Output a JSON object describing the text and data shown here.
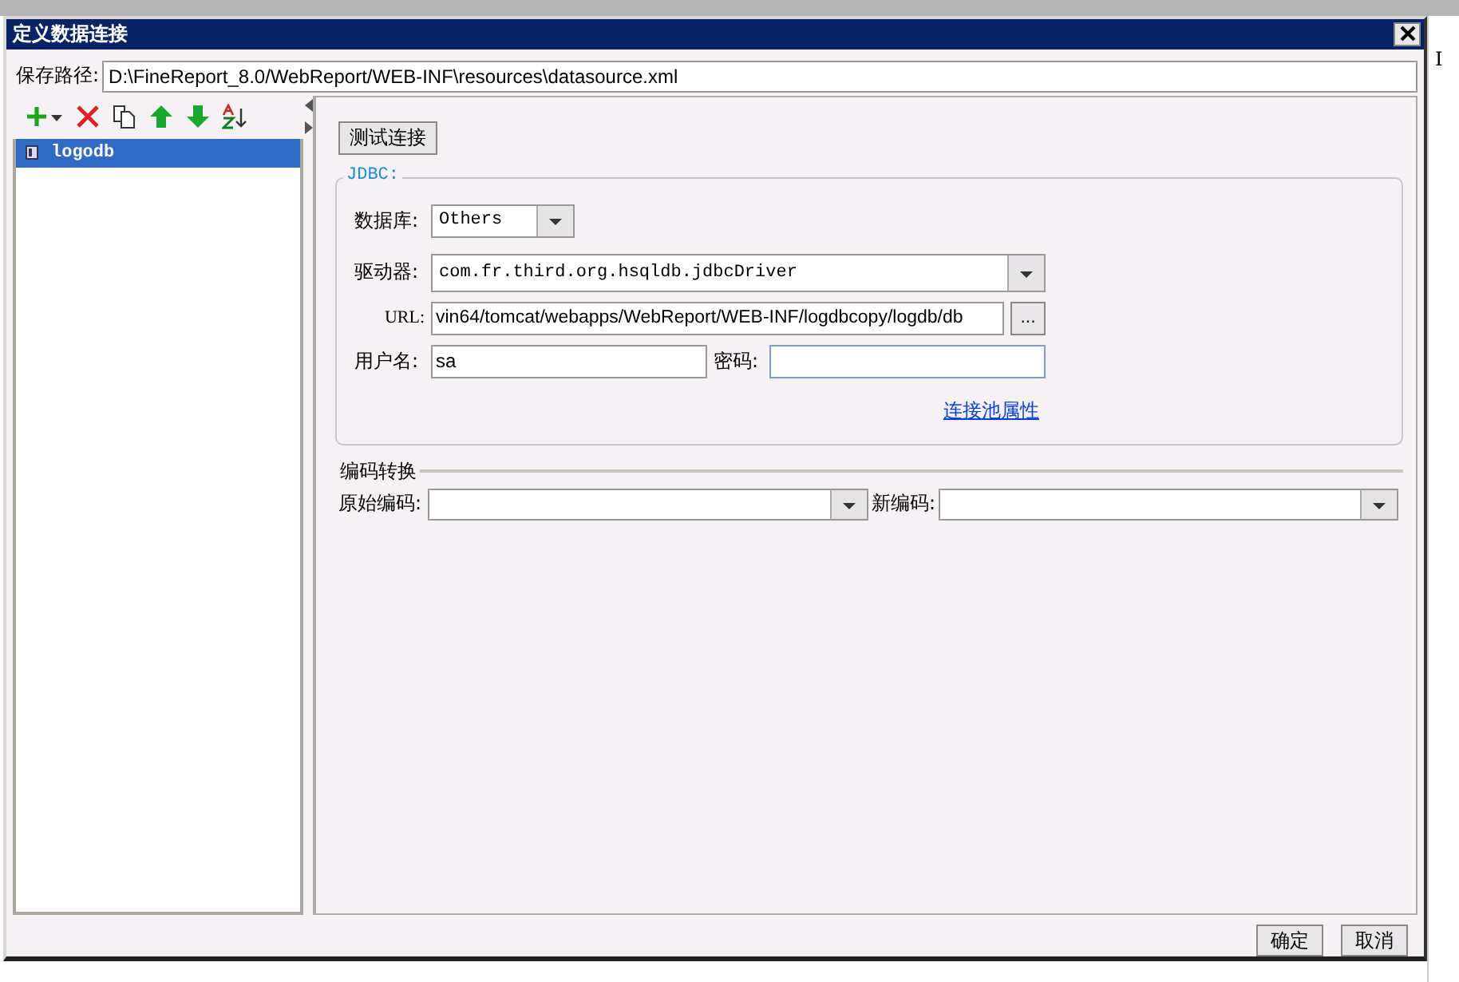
{
  "window": {
    "title": "定义数据连接"
  },
  "save_path": {
    "label": "保存路径:",
    "value": "D:\\FineReport_8.0/WebReport/WEB-INF\\resources\\datasource.xml"
  },
  "connections": [
    {
      "name": "logodb",
      "selected": true
    }
  ],
  "test_button": "测试连接",
  "jdbc": {
    "legend": "JDBC:",
    "database": {
      "label": "数据库:",
      "value": "Others"
    },
    "driver": {
      "label": "驱动器:",
      "value": "com.fr.third.org.hsqldb.jdbcDriver"
    },
    "url": {
      "label": "URL:",
      "value": "vin64/tomcat/webapps/WebReport/WEB-INF/logdbcopy/logdb/db",
      "browse": "..."
    },
    "username": {
      "label": "用户名:",
      "value": "sa"
    },
    "password": {
      "label": "密码:"
    },
    "pool_link": "连接池属性"
  },
  "encoding": {
    "legend": "编码转换",
    "original": {
      "label": "原始编码:"
    },
    "new": {
      "label": "新编码:"
    }
  },
  "buttons": [
    "确定",
    "取消"
  ],
  "background_sheet": {
    "column_header": "I"
  }
}
